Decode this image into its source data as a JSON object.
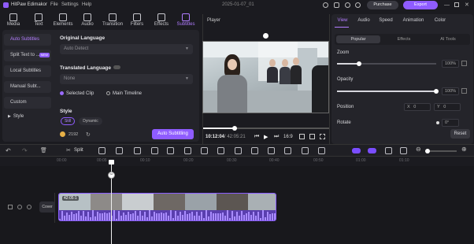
{
  "app": {
    "title": "HitPaw Edimakor",
    "menu": [
      "File",
      "Settings",
      "Help"
    ],
    "date": "2025-01-07_01",
    "purchase": "Purchase",
    "export": "Export"
  },
  "toolbar": [
    {
      "label": "Media",
      "icon": "media-icon"
    },
    {
      "label": "Text",
      "icon": "text-icon"
    },
    {
      "label": "Elements",
      "icon": "elements-icon"
    },
    {
      "label": "Audio",
      "icon": "audio-icon"
    },
    {
      "label": "Transition",
      "icon": "transition-icon"
    },
    {
      "label": "Filters",
      "icon": "filters-icon"
    },
    {
      "label": "Effects",
      "icon": "effects-icon"
    },
    {
      "label": "Subtitles",
      "icon": "subtitles-icon"
    }
  ],
  "sidenav": [
    {
      "label": "Auto Subtitles"
    },
    {
      "label": "Split Text to ...",
      "badge": "NEW"
    },
    {
      "label": "Local Subtitles"
    },
    {
      "label": "Manual Subt..."
    },
    {
      "label": "Custom"
    },
    {
      "label": "Style"
    }
  ],
  "original_language": {
    "title": "Original Language",
    "value": "Auto Detect"
  },
  "translated_language": {
    "title": "Translated Language",
    "value": "None"
  },
  "scope": {
    "selected": "Selected Clip",
    "other": "Main Timeline"
  },
  "style": {
    "title": "Style",
    "opt1": "Still",
    "opt2": "Dynamic"
  },
  "credits": "2192",
  "auto_button": "Auto Subtitling",
  "player": {
    "title": "Player",
    "time": "10:12:04",
    "duration": "/ 42:05:21",
    "ratio": "16:9"
  },
  "right_tabs": [
    "View",
    "Audio",
    "Speed",
    "Animation",
    "Color"
  ],
  "sub_tabs": [
    "Popular",
    "Effects",
    "AI Tools"
  ],
  "props": {
    "zoom": "Zoom",
    "zoom_val": "100%",
    "opacity": "Opacity",
    "opacity_val": "100%",
    "position": "Position",
    "x": "X",
    "xv": "0",
    "y": "Y",
    "yv": "0",
    "rotate": "Rotate",
    "rotate_val": "0°",
    "reset": "Reset"
  },
  "timeline": {
    "split": "Split",
    "cover": "Cover",
    "clip_time": "42:05:1"
  },
  "ruler": [
    "00:00",
    "00:05",
    "00:10",
    "00:20",
    "00:30",
    "00:40",
    "00:50",
    "01:00",
    "01:10"
  ],
  "zoom_level": 0.6
}
